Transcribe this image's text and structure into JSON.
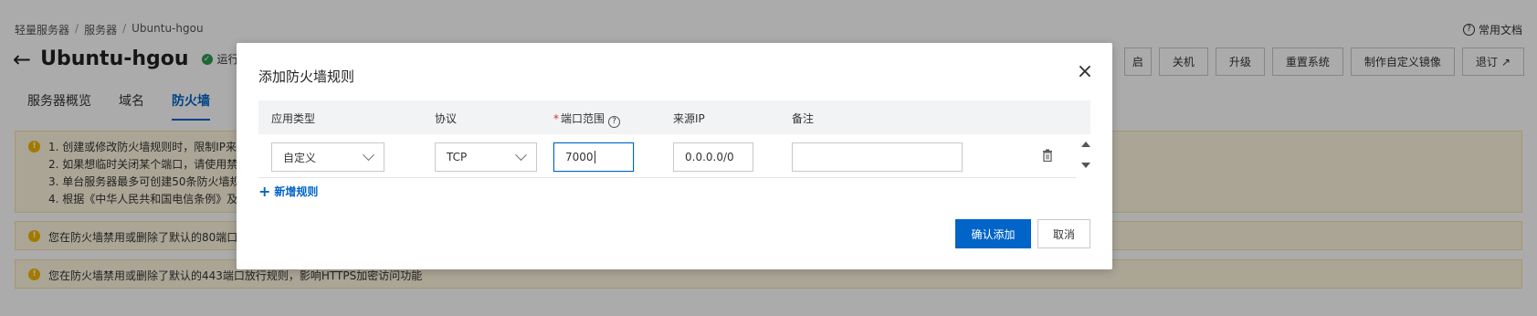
{
  "breadcrumb": [
    "轻量服务器",
    "服务器",
    "Ubuntu-hgou"
  ],
  "breadcrumb_sep": "/",
  "help_link": "常用文档",
  "server": {
    "name": "Ubuntu-hgou",
    "status": "运行中"
  },
  "actions": [
    "启",
    "关机",
    "升级",
    "重置系统",
    "制作自定义镜像",
    "退订"
  ],
  "tabs": [
    "服务器概览",
    "域名",
    "防火墙"
  ],
  "active_tab": "防火墙",
  "notices": {
    "list": [
      "1. 创建或修改防火墙规则时，限制IP来",
      "2. 如果想临时关闭某个端口，请使用禁",
      "3. 单台服务器最多可创建50条防火墙规",
      "4. 根据《中华人民共和国电信条例》及"
    ],
    "n2": "您在防火墙禁用或删除了默认的80端口",
    "n3": "您在防火墙禁用或删除了默认的443端口放行规则，影响HTTPS加密访问功能"
  },
  "modal": {
    "title": "添加防火墙规则",
    "columns": {
      "app_type": "应用类型",
      "protocol": "协议",
      "port_range": "端口范围",
      "source_ip": "来源IP",
      "note": "备注"
    },
    "row": {
      "app_type": "自定义",
      "protocol": "TCP",
      "port_range": "7000",
      "source_ip": "0.0.0.0/0",
      "note": ""
    },
    "add_rule": "新增规则",
    "confirm": "确认添加",
    "cancel": "取消"
  },
  "colors": {
    "primary": "#0064c8",
    "warning_bg": "#fff7e0",
    "required": "#d93026"
  }
}
